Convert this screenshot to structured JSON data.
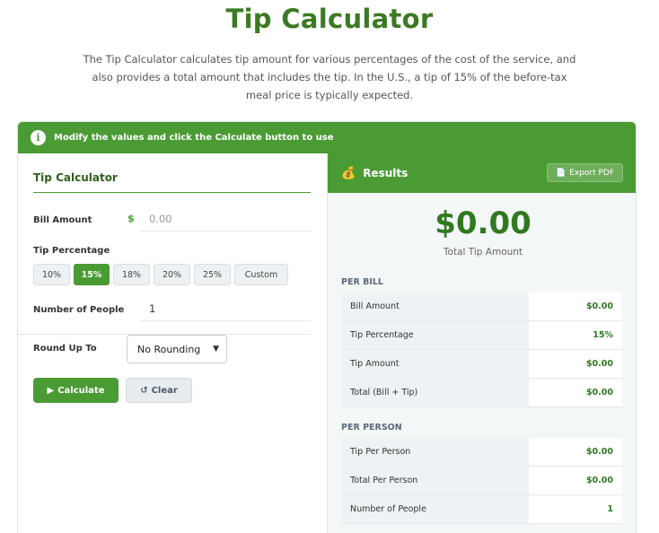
{
  "header": {
    "title": "Tip Calculator",
    "intro": "The Tip Calculator calculates tip amount for various percentages of the cost of the service, and also provides a total amount that includes the tip. In the U.S., a tip of 15% of the before-tax meal price is typically expected."
  },
  "banner": {
    "icon": "info-icon",
    "text": "Modify the values and click the Calculate button to use"
  },
  "form": {
    "title": "Tip Calculator",
    "bill_label": "Bill Amount",
    "currency_symbol": "$",
    "bill_placeholder": "0.00",
    "tip_label": "Tip Percentage",
    "tip_options": [
      "10%",
      "15%",
      "18%",
      "20%",
      "25%",
      "Custom"
    ],
    "tip_selected": "15%",
    "people_label": "Number of People",
    "people_value": "1",
    "round_label": "Round Up To",
    "round_value": "No Rounding",
    "calculate_label": "Calculate",
    "clear_label": "Clear"
  },
  "results": {
    "title": "Results",
    "icon": "money-bag-icon",
    "export_label": "Export PDF",
    "total_tip": "$0.00",
    "total_tip_caption": "Total Tip Amount",
    "per_bill_label": "PER BILL",
    "per_bill": [
      {
        "label": "Bill Amount",
        "value": "$0.00"
      },
      {
        "label": "Tip Percentage",
        "value": "15%"
      },
      {
        "label": "Tip Amount",
        "value": "$0.00"
      },
      {
        "label": "Total (Bill + Tip)",
        "value": "$0.00"
      }
    ],
    "per_person_label": "PER PERSON",
    "per_person": [
      {
        "label": "Tip Per Person",
        "value": "$0.00"
      },
      {
        "label": "Total Per Person",
        "value": "$0.00"
      },
      {
        "label": "Number of People",
        "value": "1"
      }
    ]
  },
  "colors": {
    "accent": "#4b9b35",
    "title": "#3b7a22",
    "value": "#2e7a1f"
  }
}
